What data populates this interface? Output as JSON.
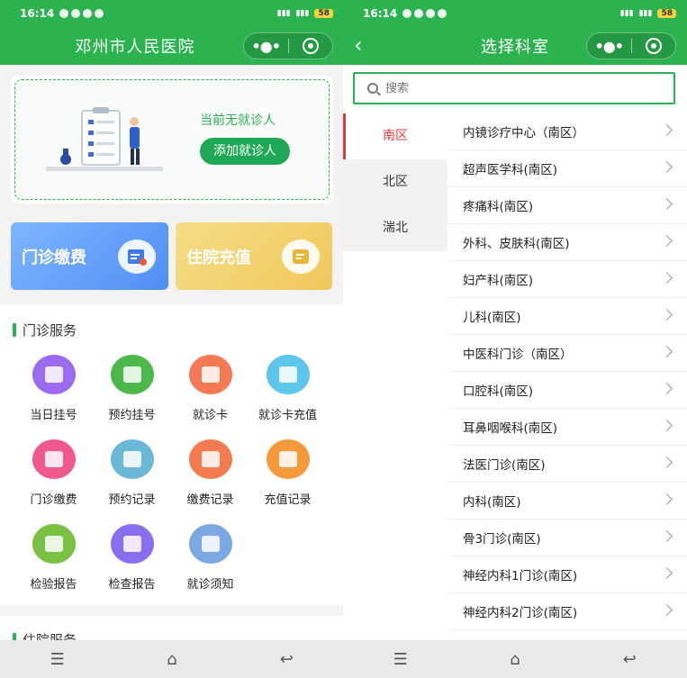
{
  "status": {
    "time": "16:14",
    "battery": "58"
  },
  "home": {
    "title": "邓州市人民医院",
    "patient": {
      "message": "当前无就诊人",
      "add_label": "添加就诊人"
    },
    "tiles": {
      "clinic_label": "门诊缴费",
      "hospital_label": "住院充值"
    },
    "clinic_section": {
      "title": "门诊服务",
      "items": [
        {
          "label": "当日挂号",
          "color": "#9b6bf0"
        },
        {
          "label": "预约挂号",
          "color": "#4cb84c"
        },
        {
          "label": "就诊卡",
          "color": "#f47a55"
        },
        {
          "label": "就诊卡充值",
          "color": "#5cc7e8"
        },
        {
          "label": "门诊缴费",
          "color": "#f05a8a"
        },
        {
          "label": "预约记录",
          "color": "#6ab8d6"
        },
        {
          "label": "缴费记录",
          "color": "#f27b4f"
        },
        {
          "label": "充值记录",
          "color": "#f59a3c"
        },
        {
          "label": "检验报告",
          "color": "#7ac043"
        },
        {
          "label": "检查报告",
          "color": "#8a6ef0"
        },
        {
          "label": "就诊须知",
          "color": "#79a9e0"
        }
      ]
    },
    "hospital_section": {
      "title": "住院服务"
    }
  },
  "dept_select": {
    "title": "选择科室",
    "search": {
      "placeholder": "搜索"
    },
    "districts": [
      "南区",
      "北区",
      "湍北"
    ],
    "departments": [
      "内镜诊疗中心（南区）",
      "超声医学科(南区)",
      "疼痛科(南区)",
      "外科、皮肤科(南区)",
      "妇产科(南区)",
      "儿科(南区)",
      "中医科门诊（南区）",
      "口腔科(南区)",
      "耳鼻咽喉科(南区)",
      "法医门诊(南区)",
      "内科(南区)",
      "骨3门诊(南区)",
      "神经内科1门诊(南区)",
      "神经内科2门诊(南区)"
    ]
  },
  "colors": {
    "brand": "#2bb34f",
    "active_district": "#e03c3c"
  }
}
